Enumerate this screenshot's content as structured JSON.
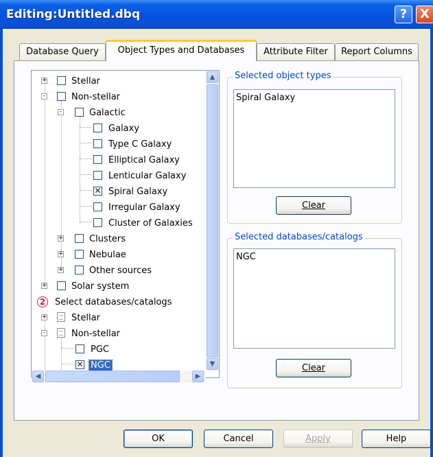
{
  "window": {
    "title": "Editing:Untitled.dbq",
    "help_glyph": "?",
    "close_glyph": "X"
  },
  "tabs": [
    {
      "label": "Database Query",
      "active": false
    },
    {
      "label": "Object Types and Databases",
      "active": true
    },
    {
      "label": "Attribute Filter",
      "active": false
    },
    {
      "label": "Report Columns",
      "active": false
    }
  ],
  "tree": {
    "rows": [
      {
        "label": "Stellar",
        "expander": "+",
        "checked": false
      },
      {
        "label": "Non-stellar",
        "expander": "-",
        "checked": false
      },
      {
        "label": "Galactic",
        "expander": "-",
        "checked": false
      },
      {
        "label": "Galaxy",
        "checked": false
      },
      {
        "label": "Type C Galaxy",
        "checked": false
      },
      {
        "label": "Elliptical Galaxy",
        "checked": false
      },
      {
        "label": "Lenticular Galaxy",
        "checked": false
      },
      {
        "label": "Spiral Galaxy",
        "checked": true
      },
      {
        "label": "Irregular Galaxy",
        "checked": false
      },
      {
        "label": "Cluster of Galaxies",
        "checked": false
      },
      {
        "label": "Clusters",
        "expander": "+",
        "checked": false
      },
      {
        "label": "Nebulae",
        "expander": "+",
        "checked": false
      },
      {
        "label": "Other sources",
        "expander": "+",
        "checked": false
      },
      {
        "label": "Solar system",
        "expander": "+",
        "checked": false
      },
      {
        "label": "Select databases/catalogs",
        "badge": "2"
      },
      {
        "label": "Stellar",
        "expander": "+"
      },
      {
        "label": "Non-stellar",
        "expander": "-"
      },
      {
        "label": "PGC",
        "checked": false
      },
      {
        "label": "NGC",
        "checked": true,
        "selected": true
      }
    ],
    "check_glyph": "✕"
  },
  "selected_object_types": {
    "title": "Selected object types",
    "items": [
      "Spiral Galaxy"
    ],
    "clear_label": "Clear"
  },
  "selected_databases": {
    "title": "Selected databases/catalogs",
    "items": [
      "NGC"
    ],
    "clear_label": "Clear"
  },
  "buttons": {
    "ok": "OK",
    "cancel": "Cancel",
    "apply": "Apply",
    "help": "Help"
  }
}
